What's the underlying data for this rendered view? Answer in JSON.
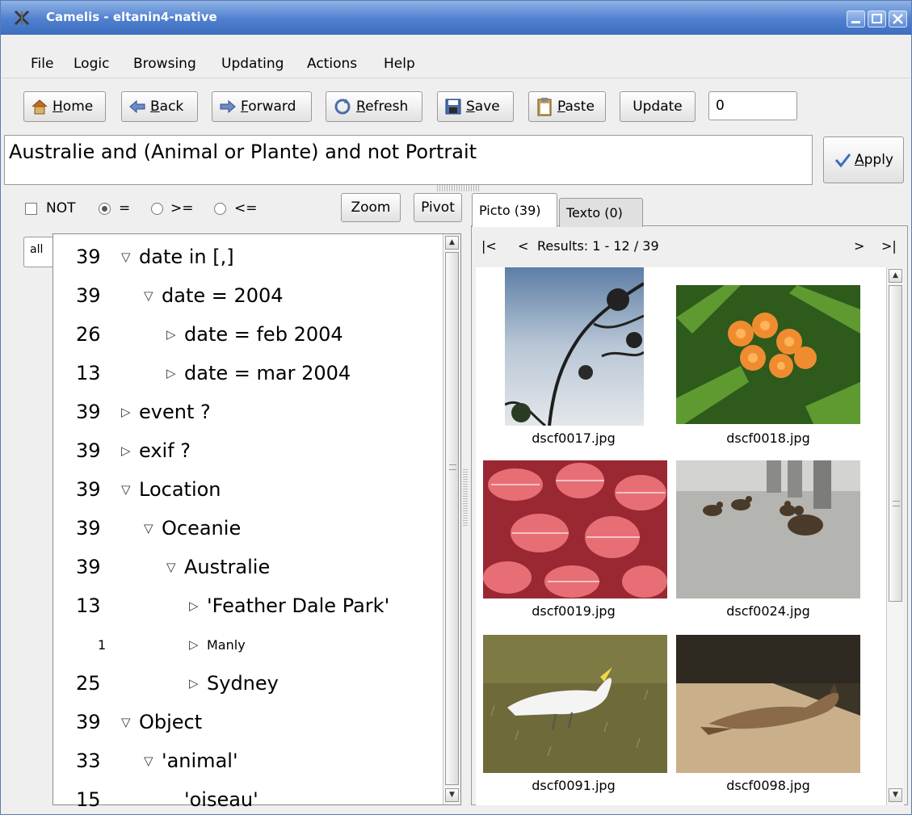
{
  "window": {
    "title": "Camelis - eltanin4-native"
  },
  "menu": [
    "File",
    "Logic",
    "Browsing",
    "Updating",
    "Actions",
    "Help"
  ],
  "toolbar": {
    "home": {
      "mnemonic": "H",
      "rest": "ome"
    },
    "back": {
      "mnemonic": "B",
      "rest": "ack"
    },
    "forward": {
      "mnemonic": "F",
      "rest": "orward"
    },
    "refresh": {
      "mnemonic": "R",
      "rest": "efresh"
    },
    "save": {
      "mnemonic": "S",
      "rest": "ave"
    },
    "paste": {
      "mnemonic": "P",
      "rest": "aste"
    },
    "update": "Update",
    "count_value": "0"
  },
  "query": {
    "text": "Australie and (Animal or Plante) and not Portrait"
  },
  "apply": {
    "mnemonic": "A",
    "rest": "pply"
  },
  "options": {
    "not_label": "NOT",
    "eq_label": "=",
    "ge_label": ">=",
    "le_label": "<=",
    "selected": "="
  },
  "nav_buttons": {
    "zoom": "Zoom",
    "pivot": "Pivot"
  },
  "side_tab": "all",
  "tree": [
    {
      "count": "39",
      "label": "date in [,]",
      "depth": 0,
      "expander": "open"
    },
    {
      "count": "39",
      "label": "date = 2004",
      "depth": 1,
      "expander": "open"
    },
    {
      "count": "26",
      "label": "date = feb 2004",
      "depth": 2,
      "expander": "closed"
    },
    {
      "count": "13",
      "label": "date = mar 2004",
      "depth": 2,
      "expander": "closed"
    },
    {
      "count": "39",
      "label": "event ?",
      "depth": 0,
      "expander": "closed"
    },
    {
      "count": "39",
      "label": "exif ?",
      "depth": 0,
      "expander": "closed"
    },
    {
      "count": "39",
      "label": "Location",
      "depth": 0,
      "expander": "open"
    },
    {
      "count": "39",
      "label": "Oceanie",
      "depth": 1,
      "expander": "open"
    },
    {
      "count": "39",
      "label": "Australie",
      "depth": 2,
      "expander": "open"
    },
    {
      "count": "13",
      "label": "'Feather Dale Park'",
      "depth": 3,
      "expander": "closed"
    },
    {
      "count": "1",
      "label": "Manly",
      "depth": 3,
      "expander": "closed",
      "small": true
    },
    {
      "count": "25",
      "label": "Sydney",
      "depth": 3,
      "expander": "closed"
    },
    {
      "count": "39",
      "label": "Object",
      "depth": 0,
      "expander": "open"
    },
    {
      "count": "33",
      "label": "'animal'",
      "depth": 1,
      "expander": "open"
    },
    {
      "count": "15",
      "label": "'oiseau'",
      "depth": 2,
      "expander": "none"
    }
  ],
  "tabs": {
    "picto": "Picto (39)",
    "texto": "Texto (0)"
  },
  "results_nav": {
    "first": "|<",
    "prev": "<",
    "summary": "Results: 1 - 12 / 39",
    "next": ">",
    "last": ">|"
  },
  "thumbnails": [
    {
      "file": "dscf0017.jpg",
      "subject": "sky with tree branches"
    },
    {
      "file": "dscf0018.jpg",
      "subject": "orange flowers"
    },
    {
      "file": "dscf0019.jpg",
      "subject": "red leaves"
    },
    {
      "file": "dscf0024.jpg",
      "subject": "ducks on pavement"
    },
    {
      "file": "dscf0091.jpg",
      "subject": "white cockatoo on grass"
    },
    {
      "file": "dscf0098.jpg",
      "subject": "kangaroo resting"
    }
  ]
}
